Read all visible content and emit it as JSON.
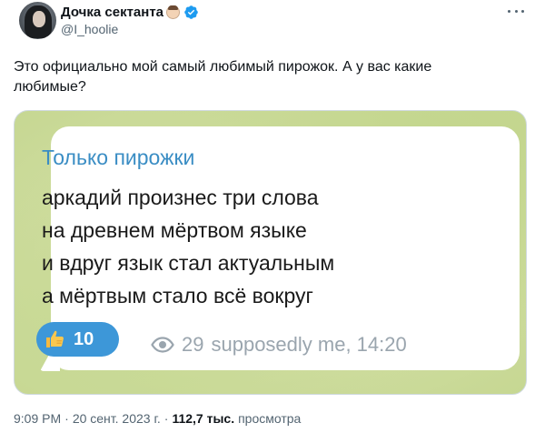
{
  "author": {
    "display_name": "Дочка сектанта",
    "handle": "@I_hoolie",
    "verified": true
  },
  "tweet": {
    "text": "Это официально мой самый любимый пирожок. А у вас какие любимые?"
  },
  "media": {
    "channel_name": "Только пирожки",
    "poem_lines": [
      "аркадий произнес три слова",
      "на древнем мёртвом языке",
      "и вдруг язык стал актуальным",
      "а мёртвым стало всё вокруг"
    ],
    "reaction_count": "10",
    "views": "29",
    "signature": "supposedly me, 14:20"
  },
  "footer": {
    "time": "9:09 PM",
    "separator": "·",
    "date": "20 сент. 2023 г.",
    "views_count": "112,7 тыс.",
    "views_label": "просмотра"
  },
  "colors": {
    "accent": "#1d9bf0",
    "channel_name": "#3a8dc4",
    "reaction_bg": "#3d97d8"
  },
  "icons": {
    "verified": "verified-badge-icon",
    "more": "more-icon",
    "thumb": "thumbs-up-icon",
    "eye": "eye-icon"
  }
}
